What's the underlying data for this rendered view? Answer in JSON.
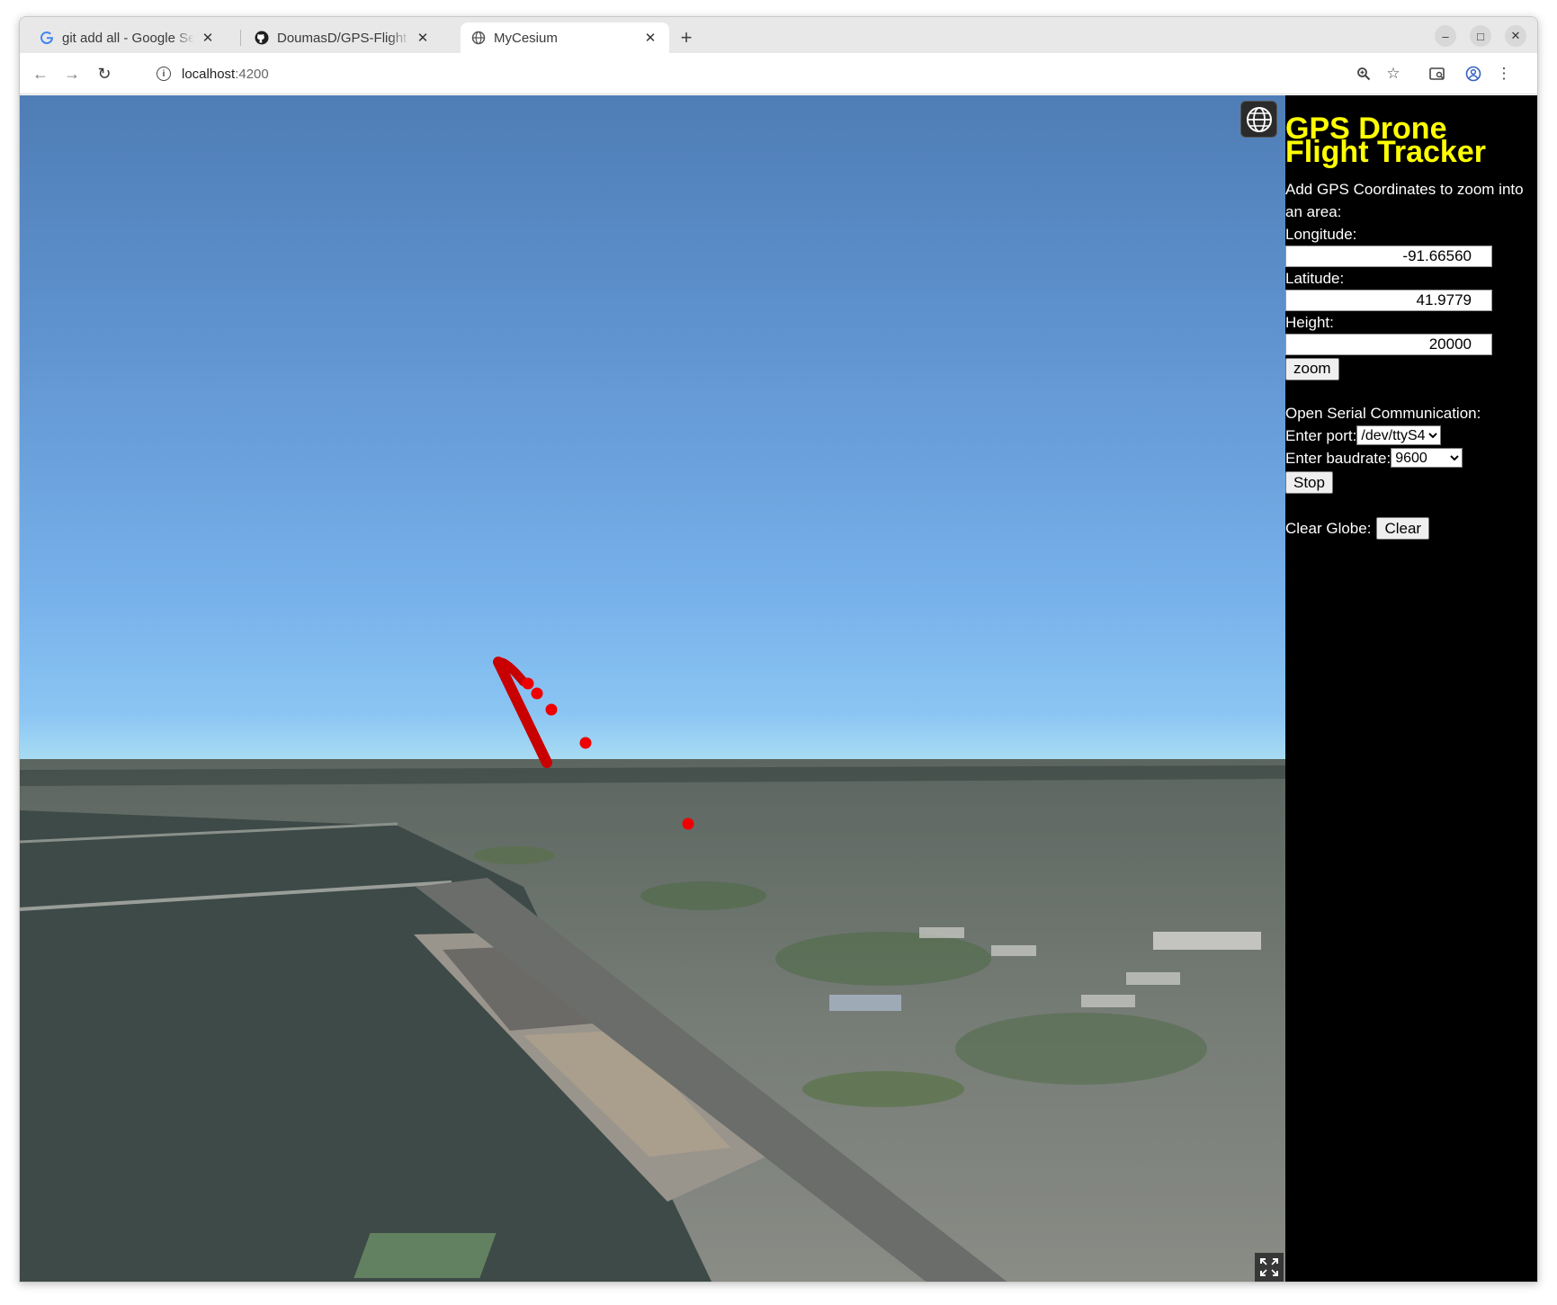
{
  "browser": {
    "tabs": [
      {
        "title": "git add all - Google Search",
        "favicon": "google-icon"
      },
      {
        "title": "DoumasD/GPS-Flight-Tracker",
        "favicon": "github-icon"
      },
      {
        "title": "MyCesium",
        "favicon": "globe-icon"
      }
    ],
    "active_tab": 2,
    "new_tab_label": "+",
    "url": {
      "host": "localhost",
      "port": ":4200"
    },
    "window_controls": {
      "minimize": "–",
      "maximize": "□",
      "close": "✕"
    }
  },
  "panel": {
    "title_line1": "GPS Drone",
    "title_line2": "Flight Tracker",
    "intro": "Add GPS Coordinates to zoom into an area:",
    "longitude_label": "Longitude:",
    "longitude_value": "-91.66560",
    "latitude_label": "Latitude:",
    "latitude_value": "41.9779",
    "height_label": "Height:",
    "height_value": "20000",
    "zoom_label": "zoom",
    "serial_label": "Open Serial Communication:",
    "port_label": "Enter port:",
    "port_value": "/dev/ttyS4",
    "baud_label": "Enter baudrate:",
    "baud_value": "9600",
    "stop_label": "Stop",
    "clear_label": "Clear Globe:",
    "clear_button": "Clear"
  },
  "colors": {
    "panel_bg": "#000000",
    "title": "#ffff00",
    "track": "#e00000"
  }
}
